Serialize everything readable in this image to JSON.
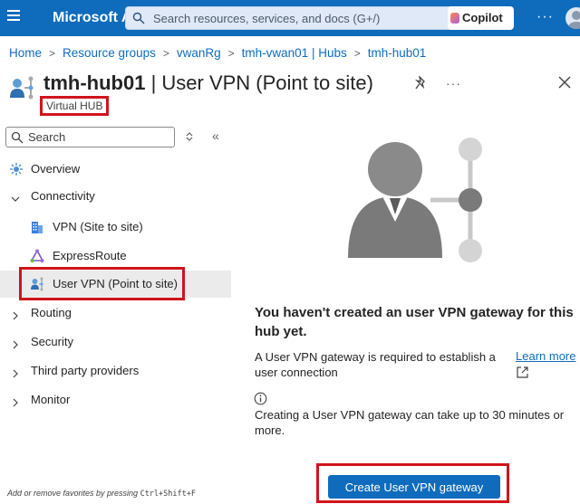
{
  "topbar": {
    "brand": "Microsoft A",
    "search_placeholder": "Search resources, services, and docs (G+/)",
    "copilot_label": "Copilot",
    "more_label": "···"
  },
  "breadcrumb": [
    "Home",
    "Resource groups",
    "vwanRg",
    "tmh-vwan01 | Hubs",
    "tmh-hub01"
  ],
  "page": {
    "title_bold": "tmh-hub01",
    "title_rest": " | User VPN (Point to site)",
    "subtitle": "Virtual HUB",
    "more_label": "···"
  },
  "sidebar": {
    "search_placeholder": "Search",
    "items": [
      {
        "label": "Overview",
        "icon": "overview-icon"
      },
      {
        "label": "Connectivity",
        "icon": "chevron-down-icon"
      },
      {
        "label": "VPN (Site to site)",
        "icon": "vpn-site-icon"
      },
      {
        "label": "ExpressRoute",
        "icon": "expressroute-icon"
      },
      {
        "label": "User VPN (Point to site)",
        "icon": "user-vpn-icon",
        "selected": true
      },
      {
        "label": "Routing",
        "icon": "chevron-right-icon"
      },
      {
        "label": "Security",
        "icon": "chevron-right-icon"
      },
      {
        "label": "Third party providers",
        "icon": "chevron-right-icon"
      },
      {
        "label": "Monitor",
        "icon": "chevron-right-icon"
      }
    ],
    "footer_prefix": "Add or remove favorites by pressing ",
    "footer_shortcut": "Ctrl+Shift+F"
  },
  "main": {
    "heading": "You haven't created an user VPN gateway for this hub yet.",
    "description": "A User VPN gateway is required to establish a user connection",
    "learn_more": "Learn more",
    "note": "Creating a User VPN gateway can take up to 30 minutes or more.",
    "create_button": "Create User VPN gateway"
  },
  "colors": {
    "accent": "#0f6cbd",
    "highlight_border": "#d0141c",
    "selected_bg": "#ebebeb"
  }
}
